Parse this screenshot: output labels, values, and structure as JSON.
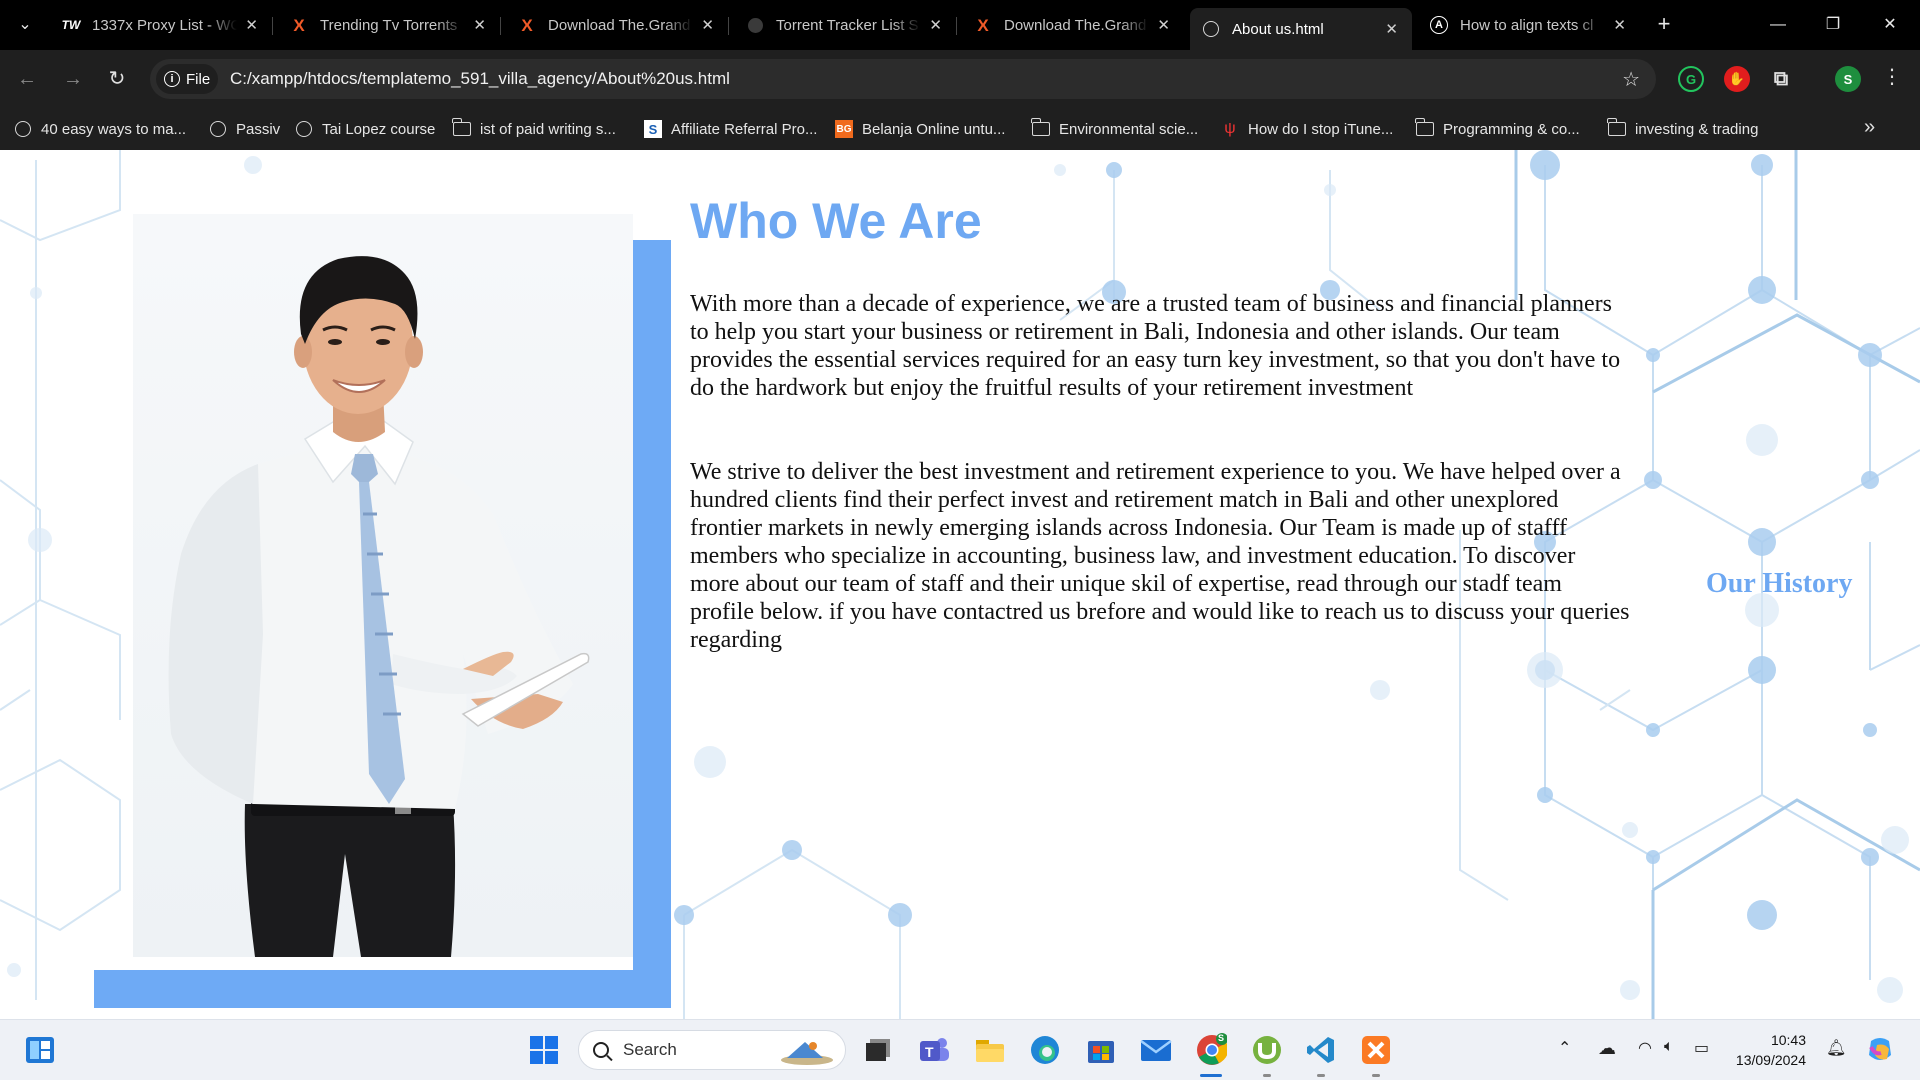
{
  "browser": {
    "tabs": [
      {
        "title": "1337x Proxy List - WC",
        "icon": "tw-icon",
        "active": false
      },
      {
        "title": "Trending Tv Torrents",
        "icon": "x-logo-icon",
        "active": false
      },
      {
        "title": "Download The.Grand",
        "icon": "x-logo-icon",
        "active": false
      },
      {
        "title": "Torrent Tracker List S",
        "icon": "globe-icon",
        "active": false
      },
      {
        "title": "Download The.Grand",
        "icon": "x-logo-icon",
        "active": false
      },
      {
        "title": "About us.html",
        "icon": "globe-icon",
        "active": true
      },
      {
        "title": "How to align texts cl",
        "icon": "ai-icon",
        "active": false
      }
    ],
    "address": {
      "chip_label": "File",
      "url": "C:/xampp/htdocs/templatemo_591_villa_agency/About%20us.html"
    },
    "profile_initial": "S",
    "bookmarks": [
      {
        "label": "40 easy ways to ma...",
        "icon": "globe-icon"
      },
      {
        "label": "Passiv",
        "icon": "globe-icon"
      },
      {
        "label": "Tai Lopez course",
        "icon": "globe-icon"
      },
      {
        "label": "ist of paid writing s...",
        "icon": "folder-icon"
      },
      {
        "label": "Affiliate Referral Pro...",
        "icon": "s-logo-icon"
      },
      {
        "label": "Belanja Online untu...",
        "icon": "bg-logo-icon"
      },
      {
        "label": "Environmental scie...",
        "icon": "folder-icon"
      },
      {
        "label": "How do I stop iTune...",
        "icon": "fork-icon"
      },
      {
        "label": "Programming & co...",
        "icon": "folder-icon"
      },
      {
        "label": "investing & trading",
        "icon": "folder-icon"
      }
    ]
  },
  "page": {
    "title": "Who We Are",
    "paragraph_1": "With more than a decade of experience, we are a trusted team of business and financial planners to help you start your business or retirement in Bali, Indonesia and other islands. Our team provides the essential services required for an easy turn key investment, so that you don't have to do the hardwork but enjoy the fruitful results of your retirement investment",
    "paragraph_2": "We strive to deliver the best investment and retirement experience to you. We have helped over a hundred clients find their perfect invest and retirement match in Bali and other unexplored frontier markets in newly emerging islands across Indonesia. Our Team is made up of stafff members who specialize in accounting, business law, and investment education. To discover more about our team of staff and their unique skil of expertise, read through our stadf team profile below. if you have contactred us brefore and would like to reach us to discuss your queries regarding",
    "side_heading": "Our History",
    "accent_color": "#6ea8f2"
  },
  "taskbar": {
    "search_placeholder": "Search",
    "time": "10:43",
    "date": "13/09/2024",
    "chrome_badge": "S"
  }
}
